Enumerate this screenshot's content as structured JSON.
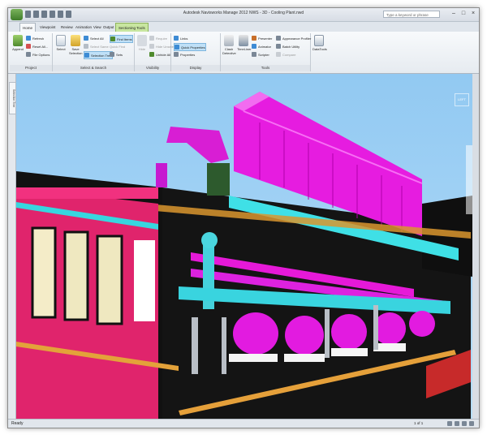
{
  "window": {
    "title": "Autodesk Navisworks Manage 2012   NWS - 3D - Cooling Plant.nwd",
    "search_placeholder": "Type a keyword or phrase"
  },
  "tabs": [
    {
      "label": "Home",
      "active": true
    },
    {
      "label": "Viewpoint"
    },
    {
      "label": "Review"
    },
    {
      "label": "Animation"
    },
    {
      "label": "View"
    },
    {
      "label": "Output"
    },
    {
      "label": "Sectioning Tools",
      "contextual": true
    }
  ],
  "ribbon": {
    "project": {
      "label": "Project",
      "append": "Append",
      "refresh": "Refresh",
      "reset_all": "Reset All...",
      "file_options": "File Options"
    },
    "select_search": {
      "label": "Select & Search",
      "select": "Select",
      "save_selection": "Save Selection",
      "select_all": "Select All",
      "select_same": "Select Same",
      "selection_tree": "Selection Tree",
      "find_items": "Find Items",
      "quick_find": "Quick Find",
      "sets": "Sets"
    },
    "visibility": {
      "label": "Visibility",
      "hide": "Hide",
      "require": "Require",
      "hide_unselected": "Hide Unselected",
      "unhide_all": "Unhide All"
    },
    "display": {
      "label": "Display",
      "links": "Links",
      "quick_properties": "Quick Properties",
      "properties": "Properties"
    },
    "tools": {
      "label": "Tools",
      "clash_detective": "Clash Detective",
      "timeliner": "TimeLiner",
      "presenter": "Presenter",
      "animator": "Animator",
      "scripter": "Scripter",
      "appearance_profiler": "Appearance Profiler",
      "batch_utility": "Batch Utility",
      "compare": "Compare",
      "datatools": "DataTools"
    }
  },
  "sidebar": {
    "tab_label": "Selection Tree"
  },
  "viewcube": {
    "label": "LEFT"
  },
  "statusbar": {
    "status": "Ready",
    "page": "1 of 1"
  },
  "colors": {
    "sky": "#9dd0f4",
    "magenta": "#e61ce0",
    "cyan": "#3fe0e6",
    "orange": "#e0a23a",
    "floor": "#111111",
    "wall_pink": "#e0246c"
  }
}
